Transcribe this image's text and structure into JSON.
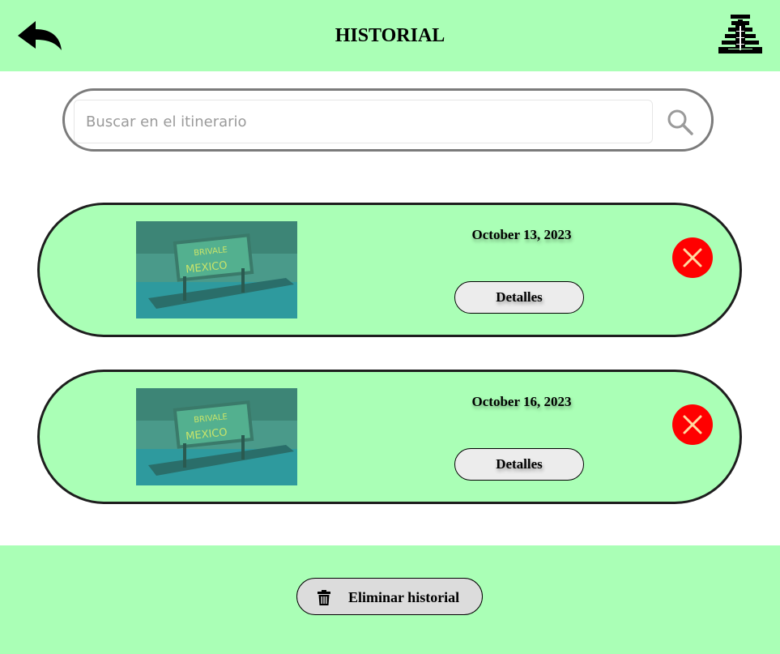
{
  "header": {
    "title": "HISTORIAL",
    "back_icon": "back-arrow-icon",
    "logo_icon": "pyramid-icon",
    "background": "#aaffb6"
  },
  "search": {
    "value": "",
    "placeholder": "Buscar en el itinerario",
    "icon": "search-icon"
  },
  "history": {
    "items": [
      {
        "date": "October 13, 2023",
        "details_label": "Detalles",
        "delete_icon": "close-icon"
      },
      {
        "date": "October 16, 2023",
        "details_label": "Detalles",
        "delete_icon": "close-icon"
      }
    ]
  },
  "footer": {
    "clear_label": "Eliminar historial",
    "clear_icon": "trash-icon"
  },
  "colors": {
    "accent_green": "#aaffb6",
    "delete_red": "#ff0000",
    "button_gray": "#ececec"
  }
}
